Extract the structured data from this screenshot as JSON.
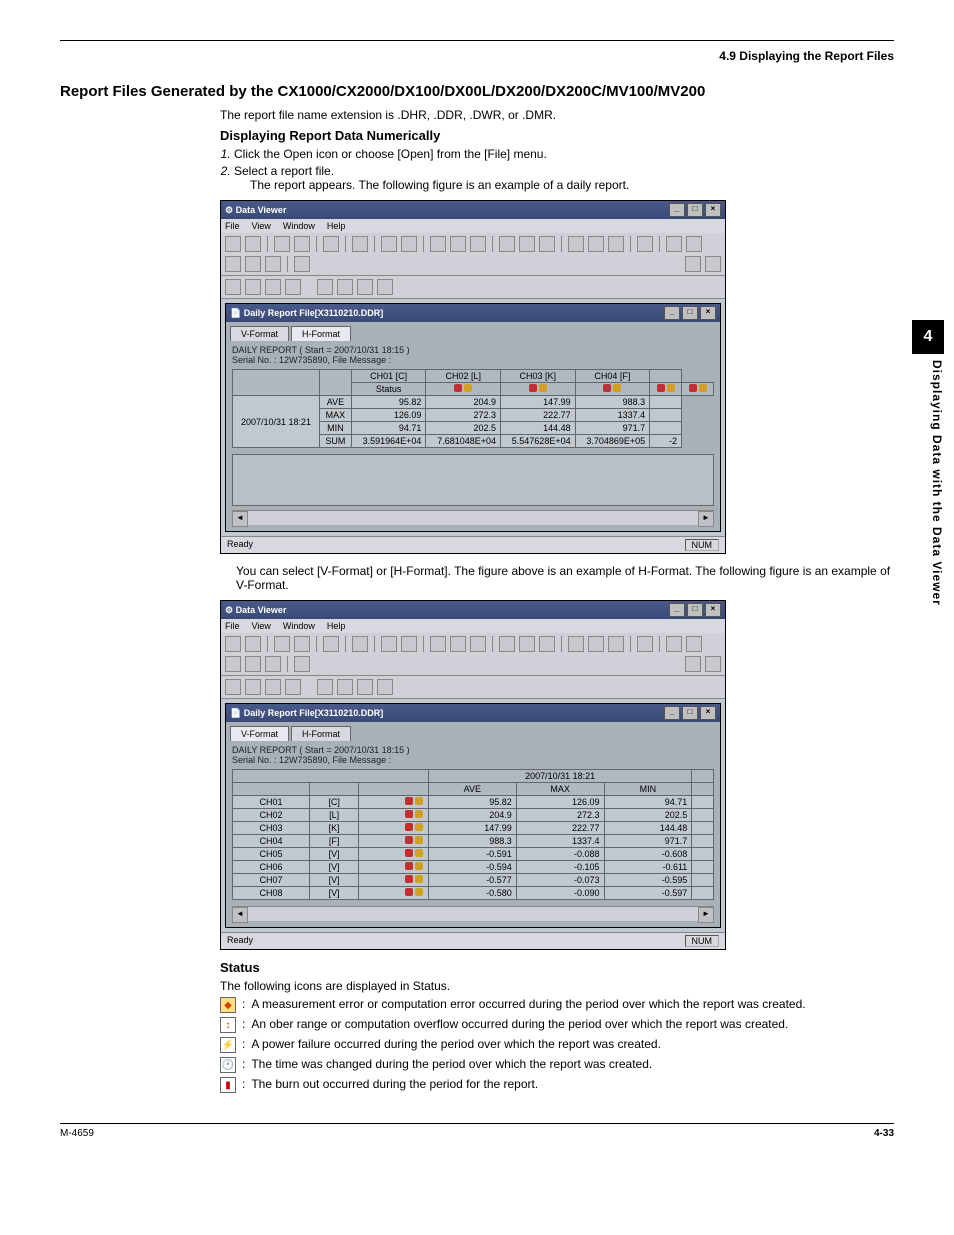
{
  "header": "4.9  Displaying the Report Files",
  "side_tab": "4",
  "side_label": "Displaying Data with the Data Viewer",
  "title": "Report Files Generated by the CX1000/CX2000/DX100/DX00L/DX200/DX200C/MV100/MV200",
  "intro": "The report file name extension is .DHR, .DDR, .DWR, or .DMR.",
  "subhead1": "Displaying Report Data Numerically",
  "steps": {
    "s1_num": "1.",
    "s1": "Click the Open icon or choose [Open] from the [File] menu.",
    "s2_num": "2.",
    "s2": "Select a report file.",
    "s2_after": "The report appears. The following figure is an example of a daily report."
  },
  "app_title": "Data Viewer",
  "menu": {
    "file": "File",
    "view": "View",
    "window": "Window",
    "help": "Help"
  },
  "child_title": "Daily Report File[X3110210.DDR]",
  "tabs": {
    "v": "V-Format",
    "h": "H-Format"
  },
  "report_info_line1": "DAILY REPORT ( Start = 2007/10/31 18:15 )",
  "report_info_line2": "Serial No. : 12W735890, File Message :",
  "h_table": {
    "headers": [
      "",
      "Status",
      "CH01 [C]",
      "CH02 [L]",
      "CH03 [K]",
      "CH04 [F]"
    ],
    "date": "2007/10/31 18:21",
    "rows": [
      {
        "lab": "AVE",
        "vals": [
          "95.82",
          "204.9",
          "147.99",
          "988.3"
        ]
      },
      {
        "lab": "MAX",
        "vals": [
          "126.09",
          "272.3",
          "222.77",
          "1337.4"
        ]
      },
      {
        "lab": "MIN",
        "vals": [
          "94.71",
          "202.5",
          "144.48",
          "971.7"
        ]
      },
      {
        "lab": "SUM",
        "vals": [
          "3.591964E+04",
          "7.681048E+04",
          "5.547628E+04",
          "3.704869E+05"
        ]
      }
    ]
  },
  "between_apps": "You can select [V-Format] or [H-Format]. The figure above is an example of H-Format. The following figure is an example of V-Format.",
  "v_table": {
    "date_header": "2007/10/31 18:21",
    "cols": [
      "",
      "",
      "",
      "AVE",
      "MAX",
      "MIN"
    ],
    "rows": [
      {
        "ch": "CH01",
        "u": "[C]",
        "vals": [
          "95.82",
          "126.09",
          "94.71"
        ]
      },
      {
        "ch": "CH02",
        "u": "[L]",
        "vals": [
          "204.9",
          "272.3",
          "202.5"
        ]
      },
      {
        "ch": "CH03",
        "u": "[K]",
        "vals": [
          "147.99",
          "222.77",
          "144.48"
        ]
      },
      {
        "ch": "CH04",
        "u": "[F]",
        "vals": [
          "988.3",
          "1337.4",
          "971.7"
        ]
      },
      {
        "ch": "CH05",
        "u": "[V]",
        "vals": [
          "-0.591",
          "-0.088",
          "-0.608"
        ]
      },
      {
        "ch": "CH06",
        "u": "[V]",
        "vals": [
          "-0.594",
          "-0.105",
          "-0.611"
        ]
      },
      {
        "ch": "CH07",
        "u": "[V]",
        "vals": [
          "-0.577",
          "-0.073",
          "-0.595"
        ]
      },
      {
        "ch": "CH08",
        "u": "[V]",
        "vals": [
          "-0.580",
          "-0.090",
          "-0.597"
        ]
      }
    ]
  },
  "status_ready": "Ready",
  "status_num": "NUM",
  "status_section": {
    "title": "Status",
    "intro": "The following icons are displayed in Status.",
    "items": [
      "A measurement error or computation error occurred during the period over which the report was created.",
      "An ober range or computation overflow occurred during the period over which the report was created.",
      "A power failure occurred during the period over which the report was created.",
      "The time was changed during the period over which the report was created.",
      "The burn out occurred during the period for the report."
    ]
  },
  "footer_left": "M-4659",
  "footer_right": "4-33"
}
